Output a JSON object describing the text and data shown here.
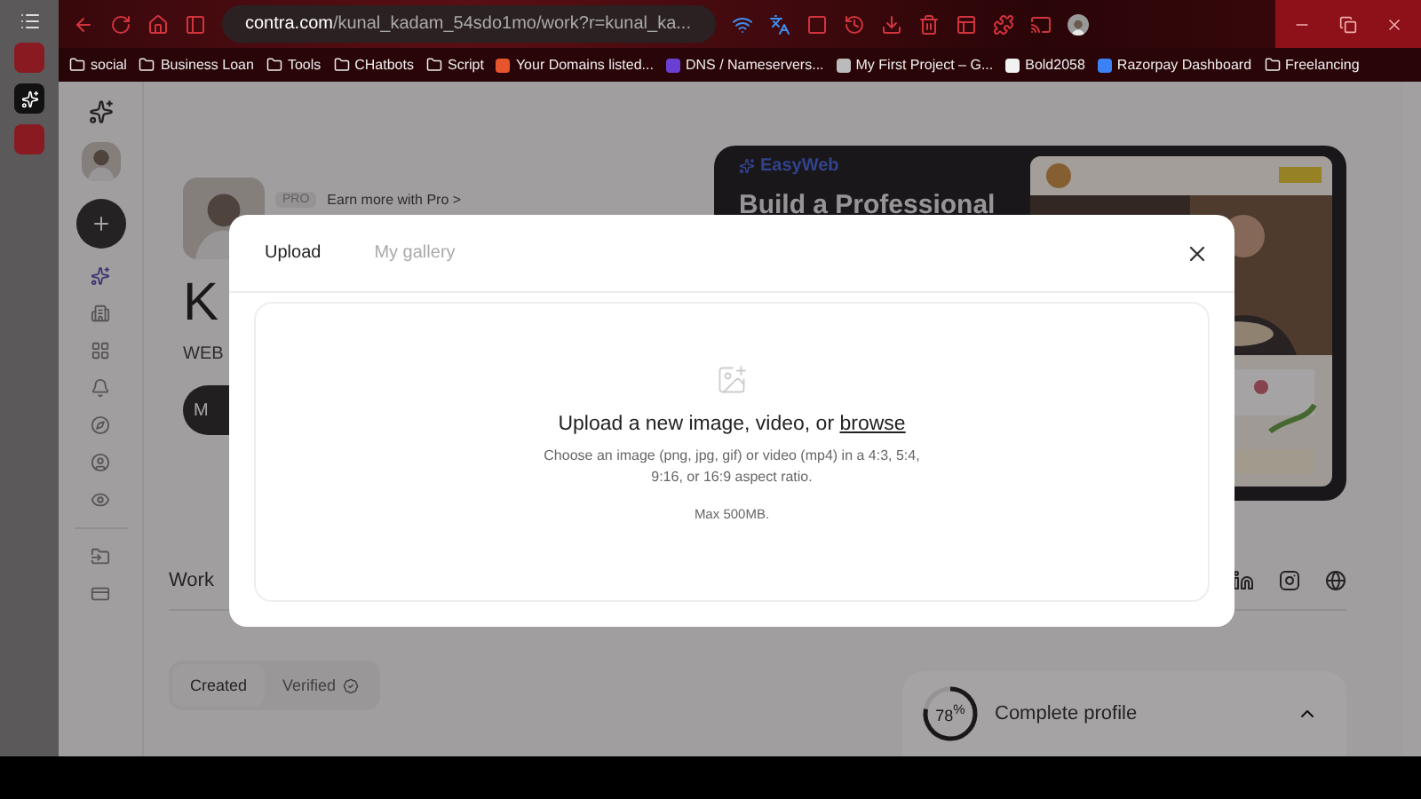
{
  "browser": {
    "address": {
      "domain": "contra.com",
      "path": "/kunal_kadam_54sdo1mo/work?r=kunal_ka..."
    },
    "bookmarks": [
      {
        "label": "social",
        "kind": "folder"
      },
      {
        "label": "Business Loan",
        "kind": "folder"
      },
      {
        "label": "Tools",
        "kind": "folder"
      },
      {
        "label": "CHatbots",
        "kind": "folder"
      },
      {
        "label": "Script",
        "kind": "folder"
      },
      {
        "label": "Your Domains listed...",
        "kind": "site",
        "color": "#e8552d"
      },
      {
        "label": "DNS / Nameservers...",
        "kind": "site",
        "color": "#6b3fd4"
      },
      {
        "label": "My First Project – G...",
        "kind": "site",
        "color": "#bbbbbb"
      },
      {
        "label": "Bold2058",
        "kind": "site",
        "color": "#f2f2f2"
      },
      {
        "label": "Razorpay Dashboard",
        "kind": "site",
        "color": "#3b82f6"
      },
      {
        "label": "Freelancing",
        "kind": "folder"
      }
    ]
  },
  "profile": {
    "pro_badge": "PRO",
    "pro_link": "Earn more with Pro >",
    "name": "K",
    "headline": "WEB",
    "button": "M"
  },
  "promo": {
    "brand": "EasyWeb",
    "headline": "Build a Professional"
  },
  "work": {
    "title": "Work"
  },
  "work_tabs": [
    {
      "label": "Created",
      "selected": true
    },
    {
      "label": "Verified",
      "selected": false
    }
  ],
  "completion": {
    "percent": "78$^{%}$",
    "level": 0.78,
    "label": "Complete profile"
  },
  "modal": {
    "tabs": [
      {
        "label": "Upload",
        "selected": true
      },
      {
        "label": "My gallery",
        "selected": false
      }
    ],
    "title": "Upload a new image, video, or ",
    "link": "browse",
    "hint": "Choose an image (png, jpg, gif) or video (mp4) in a 4:3, 5:4, 9:16, or 16:9 aspect ratio.",
    "limit": "Max 500MB."
  }
}
